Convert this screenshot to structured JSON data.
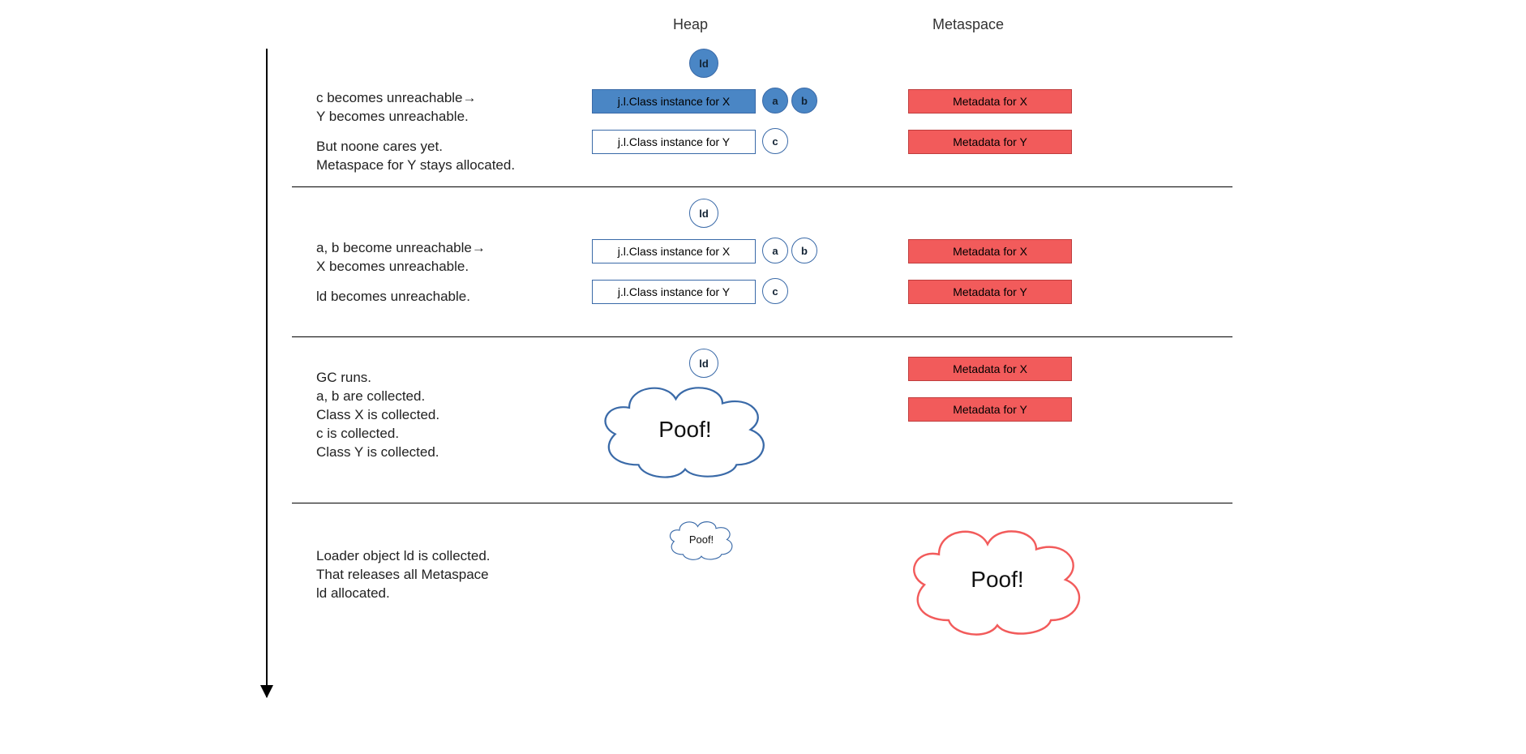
{
  "headers": {
    "heap": "Heap",
    "metaspace": "Metaspace"
  },
  "labels": {
    "ld": "ld",
    "a": "a",
    "b": "b",
    "c": "c",
    "classX": "j.l.Class instance for X",
    "classY": "j.l.Class instance for Y",
    "metaX": "Metadata for X",
    "metaY": "Metadata for Y",
    "poof": "Poof!"
  },
  "stages": {
    "s1": {
      "line1": "c becomes unreachable→\nY becomes unreachable.",
      "line2": "But noone cares yet.\nMetaspace for Y stays allocated."
    },
    "s2": {
      "line1": "a, b become unreachable→\nX becomes unreachable.",
      "line2": "ld becomes unreachable."
    },
    "s3": {
      "line1": "GC runs.\na, b are collected.\nClass X is collected.\nc  is collected.\nClass Y is collected."
    },
    "s4": {
      "line1": "Loader object ld is collected.\nThat releases all Metaspace\nld allocated."
    }
  },
  "colors": {
    "blue": "#4a86c5",
    "blueBorder": "#3a6aa8",
    "red": "#f25b5b",
    "redBorder": "#bf3d3d"
  }
}
